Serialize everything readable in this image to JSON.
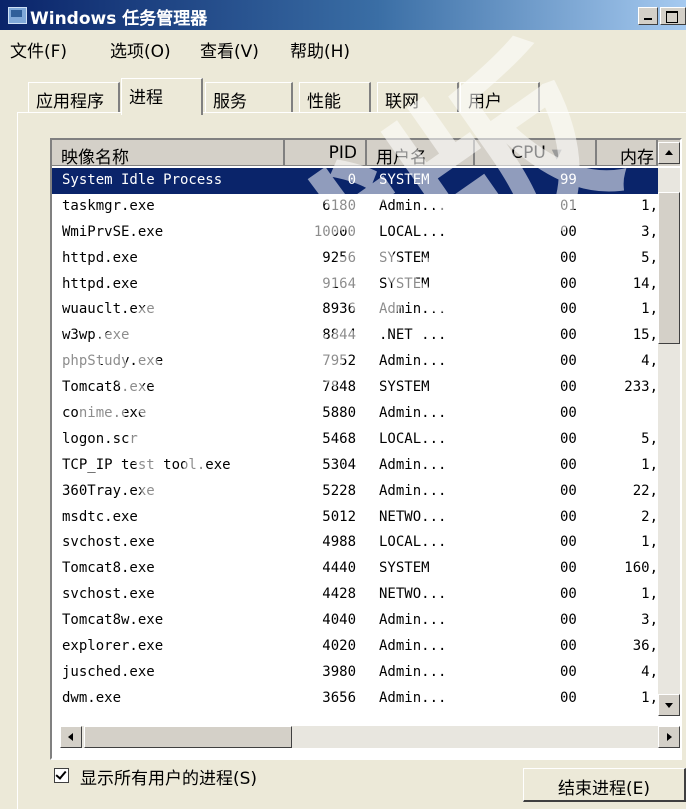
{
  "window": {
    "title": "Windows 任务管理器"
  },
  "menu": [
    "文件(F)",
    "选项(O)",
    "查看(V)",
    "帮助(H)"
  ],
  "tabs": [
    "应用程序",
    "进程",
    "服务",
    "性能",
    "联网",
    "用户"
  ],
  "active_tab": "进程",
  "columns": {
    "name": "映像名称",
    "pid": "PID",
    "user": "用户名",
    "cpu": "CPU",
    "mem": "内存"
  },
  "processes": [
    {
      "name": "System Idle Process",
      "pid": "0",
      "user": "SYSTEM",
      "cpu": "99",
      "mem": ""
    },
    {
      "name": "taskmgr.exe",
      "pid": "6180",
      "user": "Admin...",
      "cpu": "01",
      "mem": "1,"
    },
    {
      "name": "WmiPrvSE.exe",
      "pid": "10000",
      "user": "LOCAL...",
      "cpu": "00",
      "mem": "3,"
    },
    {
      "name": "httpd.exe",
      "pid": "9256",
      "user": "SYSTEM",
      "cpu": "00",
      "mem": "5,"
    },
    {
      "name": "httpd.exe",
      "pid": "9164",
      "user": "SYSTEM",
      "cpu": "00",
      "mem": "14,"
    },
    {
      "name": "wuauclt.exe",
      "pid": "8936",
      "user": "Admin...",
      "cpu": "00",
      "mem": "1,"
    },
    {
      "name": "w3wp.exe",
      "pid": "8844",
      "user": ".NET ...",
      "cpu": "00",
      "mem": "15,"
    },
    {
      "name": "phpStudy.exe",
      "pid": "7952",
      "user": "Admin...",
      "cpu": "00",
      "mem": "4,"
    },
    {
      "name": "Tomcat8.exe",
      "pid": "7848",
      "user": "SYSTEM",
      "cpu": "00",
      "mem": "233,"
    },
    {
      "name": "conime.exe",
      "pid": "5880",
      "user": "Admin...",
      "cpu": "00",
      "mem": ""
    },
    {
      "name": "logon.scr",
      "pid": "5468",
      "user": "LOCAL...",
      "cpu": "00",
      "mem": "5,"
    },
    {
      "name": "TCP_IP test tool.exe",
      "pid": "5304",
      "user": "Admin...",
      "cpu": "00",
      "mem": "1,"
    },
    {
      "name": "360Tray.exe",
      "pid": "5228",
      "user": "Admin...",
      "cpu": "00",
      "mem": "22,"
    },
    {
      "name": "msdtc.exe",
      "pid": "5012",
      "user": "NETWO...",
      "cpu": "00",
      "mem": "2,"
    },
    {
      "name": "svchost.exe",
      "pid": "4988",
      "user": "LOCAL...",
      "cpu": "00",
      "mem": "1,"
    },
    {
      "name": "Tomcat8.exe",
      "pid": "4440",
      "user": "SYSTEM",
      "cpu": "00",
      "mem": "160,"
    },
    {
      "name": "svchost.exe",
      "pid": "4428",
      "user": "NETWO...",
      "cpu": "00",
      "mem": "1,"
    },
    {
      "name": "Tomcat8w.exe",
      "pid": "4040",
      "user": "Admin...",
      "cpu": "00",
      "mem": "3,"
    },
    {
      "name": "explorer.exe",
      "pid": "4020",
      "user": "Admin...",
      "cpu": "00",
      "mem": "36,"
    },
    {
      "name": "jusched.exe",
      "pid": "3980",
      "user": "Admin...",
      "cpu": "00",
      "mem": "4,"
    },
    {
      "name": "dwm.exe",
      "pid": "3656",
      "user": "Admin...",
      "cpu": "00",
      "mem": "1,"
    }
  ],
  "show_all_users_label": "显示所有用户的进程(S)",
  "end_process_label": "结束进程(E)",
  "watermark": "测试版",
  "colors": {
    "selection": "#0a246a",
    "title_bar_start": "#0a246a",
    "title_bar_end": "#a6caf0",
    "face": "#ece9d8"
  }
}
